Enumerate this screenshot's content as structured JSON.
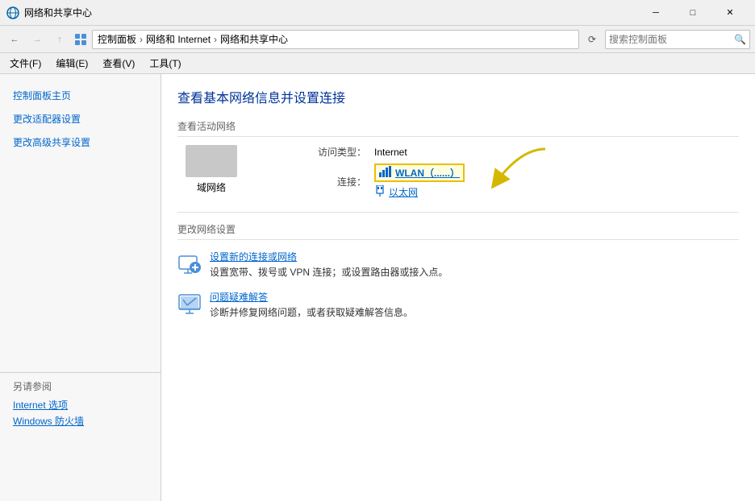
{
  "titleBar": {
    "icon": "🌐",
    "title": "网络和共享中心",
    "minimize": "─",
    "maximize": "□",
    "close": "✕"
  },
  "addressBar": {
    "back": "←",
    "forward": "→",
    "up": "↑",
    "breadcrumb": [
      {
        "label": "控制面板"
      },
      {
        "label": "网络和 Internet"
      },
      {
        "label": "网络和共享中心"
      }
    ],
    "refresh": "⟳",
    "searchPlaceholder": "搜索控制面板",
    "searchIcon": "🔍"
  },
  "menuBar": {
    "items": [
      {
        "label": "文件(F)"
      },
      {
        "label": "编辑(E)"
      },
      {
        "label": "查看(V)"
      },
      {
        "label": "工具(T)"
      }
    ]
  },
  "sidebar": {
    "items": [
      {
        "label": "控制面板主页"
      },
      {
        "label": "更改适配器设置"
      },
      {
        "label": "更改高级共享设置"
      }
    ],
    "alsoSeeTitle": "另请参阅",
    "alsoSeeItems": [
      {
        "label": "Internet 选项"
      },
      {
        "label": "Windows 防火墙"
      }
    ]
  },
  "content": {
    "pageTitle": "查看基本网络信息并设置连接",
    "activeNetworkLabel": "查看活动网络",
    "networkName": "域网络",
    "accessTypeLabel": "访问类型：",
    "accessTypeValue": "Internet",
    "connectionLabel": "连接：",
    "wlanLabel": "WLAN（",
    "wlanName": "......",
    "wlanClose": "）",
    "ethernetLabel": "以太网",
    "changeNetworkLabel": "更改网络设置",
    "setupNewLabel": "设置新的连接或网络",
    "setupNewDesc": "设置宽带、拨号或 VPN 连接；或设置路由器或接入点。",
    "troubleshootLabel": "问题疑难解答",
    "troubleshootDesc": "诊断并修复网络问题，或者获取疑难解答信息。"
  }
}
